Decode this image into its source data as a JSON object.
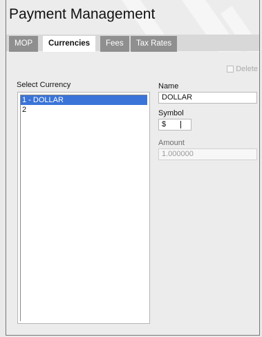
{
  "window": {
    "title": "Payment Management"
  },
  "tabs": [
    {
      "label": "MOP",
      "active": false
    },
    {
      "label": "Currencies",
      "active": true
    },
    {
      "label": "Fees",
      "active": false
    },
    {
      "label": "Tax Rates",
      "active": false
    }
  ],
  "actions": {
    "delete_label": "Delete",
    "delete_checked": false
  },
  "currency_list": {
    "label": "Select Currency",
    "items": [
      {
        "label": "1 - DOLLAR",
        "selected": true
      },
      {
        "label": "2",
        "selected": false
      }
    ]
  },
  "form": {
    "name_label": "Name",
    "name_value": "DOLLAR",
    "symbol_label": "Symbol",
    "symbol_value": "$",
    "amount_label": "Amount",
    "amount_value": "1.000000"
  },
  "colors": {
    "selected_row": "#3a74d8",
    "tab_inactive": "#8f8f8f",
    "tab_active": "#ffffff",
    "tabbar": "#d8d8d8"
  }
}
